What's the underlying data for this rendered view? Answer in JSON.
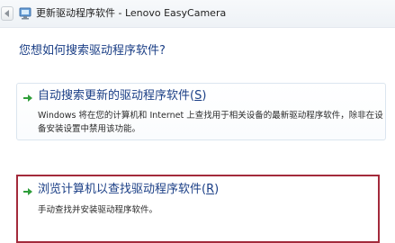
{
  "window": {
    "title": "更新驱动程序软件 - Lenovo EasyCamera"
  },
  "heading": "您想如何搜索驱动程序软件?",
  "options": [
    {
      "title": "自动搜索更新的驱动程序软件",
      "accelerator_open": "(",
      "accelerator_key": "S",
      "accelerator_close": ")",
      "description": "Windows 将在您的计算机和 Internet 上查找用于相关设备的最新驱动程序软件，除非在设备安装设置中禁用该功能。"
    },
    {
      "title": "浏览计算机以查找驱动程序软件",
      "accelerator_open": "(",
      "accelerator_key": "R",
      "accelerator_close": ")",
      "description": "手动查找并安装驱动程序软件。"
    }
  ],
  "icons": {
    "back": "back-arrow-icon",
    "device": "device-manager-icon",
    "option": "green-arrow-icon"
  },
  "colors": {
    "link_blue": "#1b3f86",
    "arrow_green": "#2f9e3a",
    "highlight_red": "#a32a3b"
  }
}
